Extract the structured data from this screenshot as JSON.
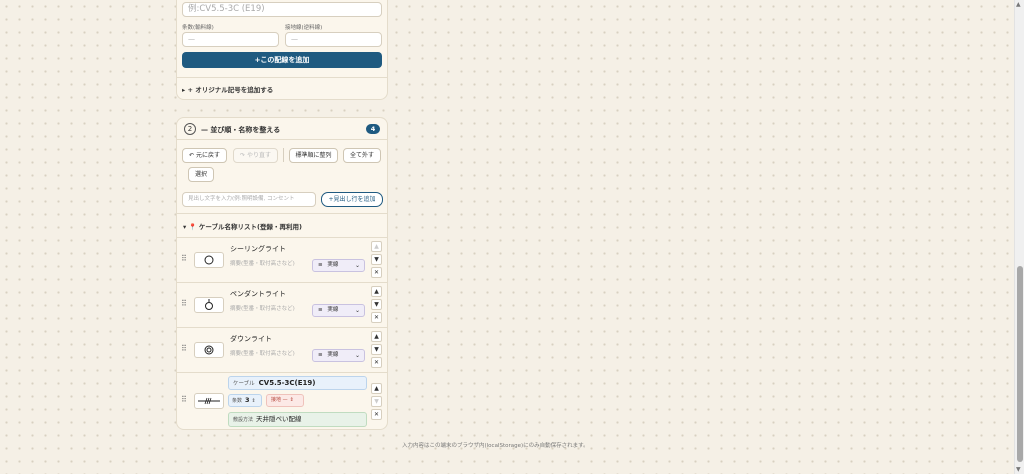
{
  "form": {
    "cable_input_placeholder": "例:CV5.5-3C (E19)",
    "cores_label": "条数(輸料線)",
    "cores_placeholder": "—",
    "ground_label": "接地線(逆料線)",
    "ground_placeholder": "—",
    "add_wiring_button": "+この配線を追加",
    "add_original_symbol": "▸ + オリジナル記号を追加する"
  },
  "step2": {
    "number": "2",
    "title": "— 並び順・名称を整える",
    "count": "4",
    "undo": "↶ 元に戻す",
    "redo": "↷ やり直す",
    "sort_standard": "標準順に整列",
    "deselect_all": "全て外す",
    "select": "選択",
    "heading_placeholder": "見出し文字を入力(例:照明設備, コンセント",
    "add_heading_button": "+見出し行を追加",
    "cable_list_title": "▾ 📍 ケーブル名称リスト(登録・再利用)"
  },
  "items": [
    {
      "name": "シーリングライト",
      "desc_placeholder": "摘要(型番・取付高さなど)",
      "line_style": "実線",
      "style_icon": "≡",
      "symbol": "ceiling-light"
    },
    {
      "name": "ペンダントライト",
      "desc_placeholder": "摘要(型番・取付高さなど)",
      "line_style": "実線",
      "style_icon": "≡",
      "symbol": "pendant-light"
    },
    {
      "name": "ダウンライト",
      "desc_placeholder": "摘要(型番・取付高さなど)",
      "line_style": "実線",
      "style_icon": "≡",
      "symbol": "downlight"
    }
  ],
  "cable_item": {
    "cable_label": "ケーブル",
    "cable_value": "CV5.5-3C(E19)",
    "cores_label": "条数",
    "cores_value": "3",
    "ground_label": "接地 —",
    "method_label": "敷設方法",
    "method_value": "天井隠ぺい配線",
    "symbol": "cable-wiring"
  },
  "controls": {
    "up": "▲",
    "down": "▼",
    "remove": "✕",
    "grip": "⠿",
    "chevron": "⌄",
    "stepper": "⇕"
  },
  "footer": "入力内容はこの端末のブラウザ内(localStorage)にのみ自動保存されます。",
  "colors": {
    "accent": "#1f5a80",
    "background": "#f5f0e6"
  }
}
